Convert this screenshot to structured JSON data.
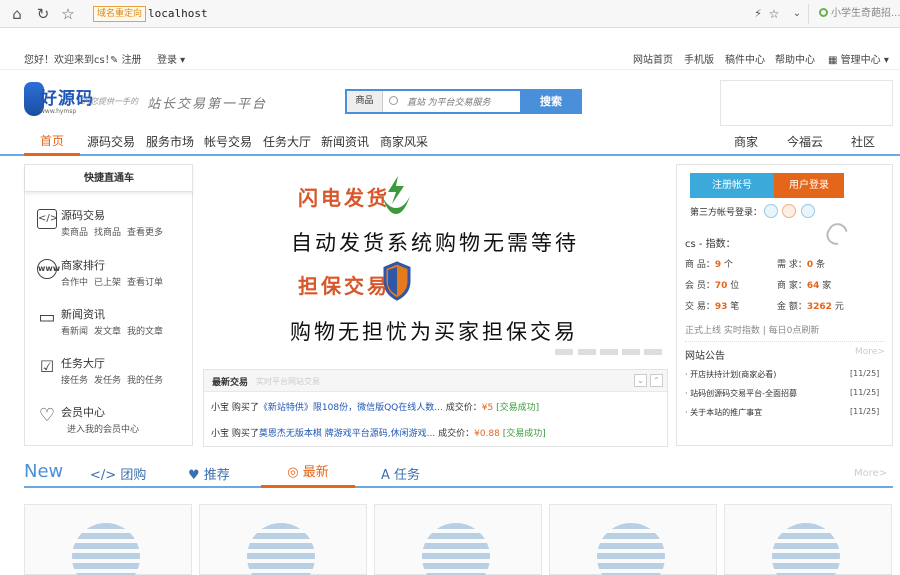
{
  "browser": {
    "url_tag": "域名重定向",
    "url": "localhost",
    "search_placeholder": "小学生奇葩招..."
  },
  "topbar": {
    "welcome": "您好！欢迎来到cs！",
    "register": "注册",
    "login": "登录",
    "links": [
      "网站首页",
      "手机版",
      "稿件中心",
      "帮助中心",
      "管理中心"
    ]
  },
  "header": {
    "logo_text": "好源码",
    "logo_sub": "www.hymsp",
    "logo_slogan": "为您提供一手的",
    "tagline": "站长交易第一平台",
    "search_type": "商品",
    "search_placeholder": "直站 为平台交易服务",
    "search_button": "搜索"
  },
  "nav": {
    "items": [
      "首页",
      "源码交易",
      "服务市场",
      "帐号交易",
      "任务大厅",
      "新闻资讯",
      "商家风采"
    ],
    "right_items": [
      "商家",
      "今福云",
      "社区"
    ]
  },
  "left_panel": {
    "title": "快捷直通车",
    "items": [
      {
        "icon": "code-icon",
        "glyph": "</>",
        "title": "源码交易",
        "subs": [
          "卖商品",
          "找商品",
          "查看更多"
        ]
      },
      {
        "icon": "www-icon",
        "glyph": "www",
        "title": "商家排行",
        "subs": [
          "合作中",
          "已上架",
          "查看订单"
        ]
      },
      {
        "icon": "monitor-icon",
        "glyph": "▭",
        "title": "新闻资讯",
        "subs": [
          "看新闻",
          "发文章",
          "我的文章"
        ]
      },
      {
        "icon": "calendar-check-icon",
        "glyph": "☑",
        "title": "任务大厅",
        "subs": [
          "接任务",
          "发任务",
          "我的任务"
        ]
      },
      {
        "icon": "heart-icon",
        "glyph": "♡",
        "title": "会员中心",
        "subs": [
          "进入我的会员中心"
        ]
      }
    ]
  },
  "banner": {
    "line1": "闪电发货",
    "line2": "自动发货系统购物无需等待",
    "line3": "担保交易",
    "line4": "购物无担忧为买家担保交易"
  },
  "trades": {
    "title": "最新交易",
    "subtitle": "实时平台网站交易",
    "rows": [
      {
        "user": "小宝",
        "action": "购买了",
        "product": "《新站特供》限108份，微信版QQ在线人数...",
        "price_label": "成交价：",
        "price": "¥5",
        "status": "[交易成功]"
      },
      {
        "user": "小宝",
        "action": "购买了",
        "product": "莫恩杰无版本棋 牌游戏平台源码,休闲游戏...",
        "price_label": "成交价：",
        "price": "¥0.88",
        "status": "[交易成功]"
      }
    ]
  },
  "right_panel": {
    "register_button": "注册帐号",
    "login_button": "用户登录",
    "third_party_label": "第三方帐号登录：",
    "user_line": "cs - 指数：",
    "stats": [
      {
        "label": "商 品：",
        "value": "9",
        "unit": "个"
      },
      {
        "label": "需 求：",
        "value": "0",
        "unit": "条"
      },
      {
        "label": "会 员：",
        "value": "70",
        "unit": "位"
      },
      {
        "label": "商 家：",
        "value": "64",
        "unit": "家"
      },
      {
        "label": "交 易：",
        "value": "93",
        "unit": "笔"
      },
      {
        "label": "金 额：",
        "value": "3262",
        "unit": "元"
      }
    ],
    "formal_line": "正式上线 实时指数 | 每日0点刷新",
    "notice_title": "网站公告",
    "notice_more": "More>",
    "notices": [
      {
        "text": "· 开店扶持计划(商家必看)",
        "date": "[11/25]"
      },
      {
        "text": "· 站码创源码交易平台-全面招募",
        "date": "[11/25]"
      },
      {
        "text": "· 关于本站的推广事宜",
        "date": "[11/25]"
      }
    ]
  },
  "tabs": {
    "new_label": "New",
    "items": [
      "团购",
      "推荐",
      "最新",
      "任务"
    ],
    "more": "More>"
  }
}
